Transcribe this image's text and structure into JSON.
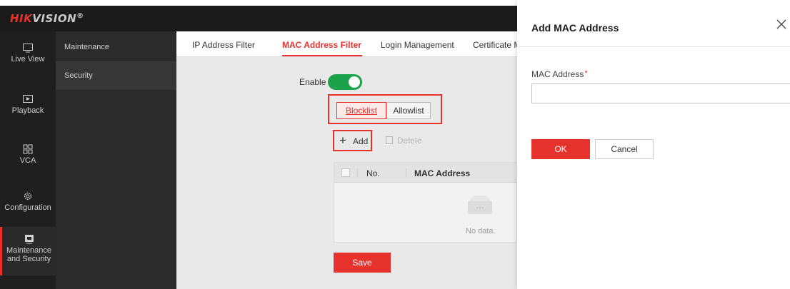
{
  "brand": {
    "name_red": "HIK",
    "name_gray": "VISION",
    "registered": "®",
    "accent": "#e5322d"
  },
  "rail": {
    "items": [
      {
        "label": "Live View",
        "icon": "monitor-icon"
      },
      {
        "label": "Playback",
        "icon": "play-icon"
      },
      {
        "label": "VCA",
        "icon": "grid-icon"
      },
      {
        "label": "Configuration",
        "icon": "gear-icon"
      },
      {
        "label_line1": "Maintenance",
        "label_line2": "and Security",
        "icon": "shield-icon",
        "active": true
      }
    ]
  },
  "submenu": {
    "items": [
      {
        "label": "Maintenance"
      },
      {
        "label": "Security",
        "active": true
      }
    ]
  },
  "tabs": [
    {
      "label": "IP Address Filter"
    },
    {
      "label": "MAC Address Filter",
      "active": true
    },
    {
      "label": "Login Management"
    },
    {
      "label": "Certificate M"
    }
  ],
  "enable": {
    "label": "Enable",
    "on": true,
    "color": "#1aa34a"
  },
  "mode": {
    "blocklist": "Blocklist",
    "allowlist": "Allowlist",
    "selected": "Blocklist"
  },
  "toolbar": {
    "add_label": "Add",
    "delete_label": "Delete"
  },
  "table": {
    "col_no": "No.",
    "col_mac": "MAC Address",
    "empty_text": "No data."
  },
  "save_label": "Save",
  "dialog": {
    "title": "Add MAC Address",
    "field_label": "MAC Address",
    "required_mark": "*",
    "field_value": "",
    "ok_label": "OK",
    "cancel_label": "Cancel"
  }
}
